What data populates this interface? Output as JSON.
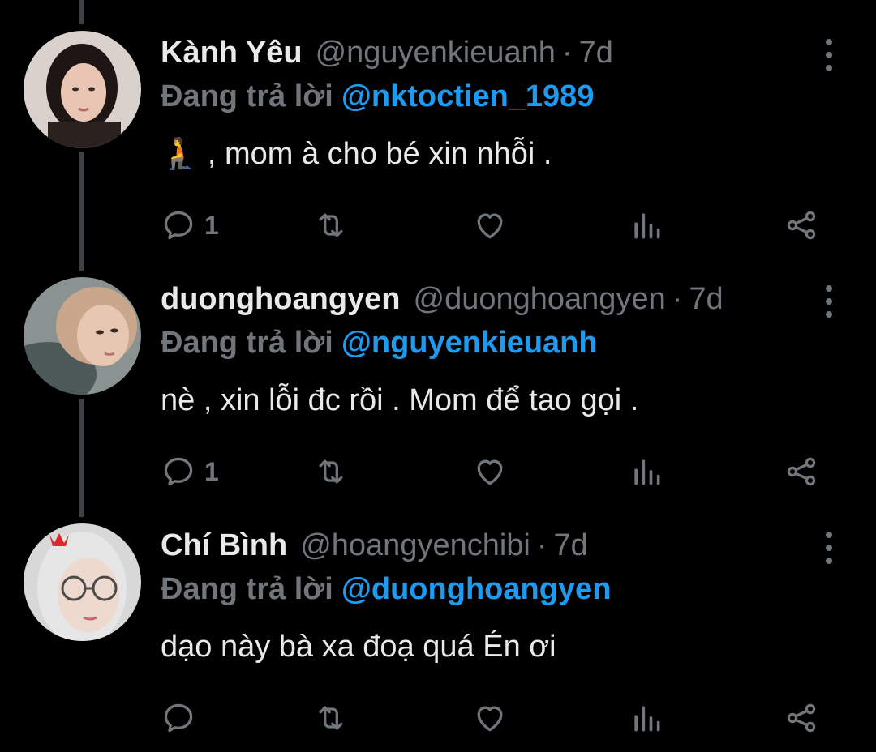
{
  "colors": {
    "background": "#000000",
    "text": "#e7e9ea",
    "muted": "#71767b",
    "link": "#1d9bf0",
    "thread_line": "#3e4144"
  },
  "tweets": [
    {
      "name": "Kành Yêu",
      "handle": "@nguyenkieuanh",
      "separator": "·",
      "time": "7d",
      "reply_prefix": "Đang trả lời",
      "reply_to": "@nktoctien_1989",
      "text": "🧎 , mom à cho bé xin nhỗi .",
      "reply_count": "1",
      "icons": [
        "reply-icon",
        "retweet-icon",
        "like-icon",
        "analytics-icon",
        "share-icon",
        "more-icon"
      ]
    },
    {
      "name": "duonghoangyen",
      "handle": "@duonghoangyen",
      "separator": "·",
      "time": "7d",
      "reply_prefix": "Đang trả lời",
      "reply_to": "@nguyenkieuanh",
      "text": "nè , xin lỗi đc rồi . Mom để tao gọi .",
      "reply_count": "1",
      "icons": [
        "reply-icon",
        "retweet-icon",
        "like-icon",
        "analytics-icon",
        "share-icon",
        "more-icon"
      ]
    },
    {
      "name": "Chí Bình",
      "handle": "@hoangyenchibi",
      "separator": "·",
      "time": "7d",
      "reply_prefix": "Đang trả lời",
      "reply_to": "@duonghoangyen",
      "text": "dạo này bà xa đoạ quá Én ơi",
      "reply_count": "",
      "icons": [
        "reply-icon",
        "retweet-icon",
        "like-icon",
        "analytics-icon",
        "share-icon",
        "more-icon"
      ]
    }
  ]
}
